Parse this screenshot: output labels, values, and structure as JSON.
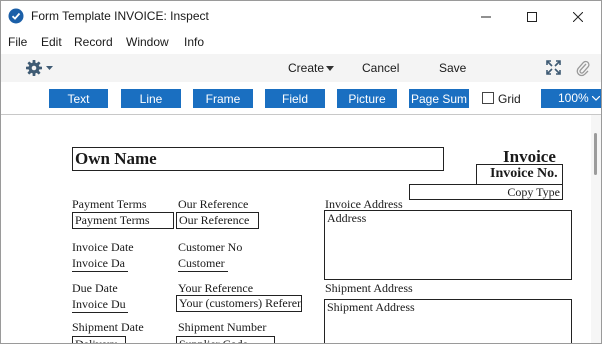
{
  "window": {
    "title": "Form Template INVOICE: Inspect"
  },
  "menu": [
    "File",
    "Edit",
    "Record",
    "Window",
    "Info"
  ],
  "toolbar": {
    "create_label": "Create",
    "cancel_label": "Cancel",
    "save_label": "Save"
  },
  "tools": [
    "Text",
    "Line",
    "Frame",
    "Field",
    "Picture",
    "Page Sum"
  ],
  "grid_label": "Grid",
  "zoom_value": "100%",
  "colors": {
    "accent": "#1a6fc1"
  },
  "form": {
    "own_name": "Own Name",
    "invoice_title": "Invoice",
    "invoice_no": "Invoice No.",
    "copy_type": "Copy Type",
    "payment_terms_label": "Payment Terms",
    "payment_terms_field": "Payment Terms",
    "our_reference_label": "Our Reference",
    "our_reference_field": "Our Reference",
    "invoice_address_label": "Invoice Address",
    "address_field": "Address",
    "invoice_date_label": "Invoice Date",
    "invoice_date_field": "Invoice Da",
    "customer_no_label": "Customer No",
    "customer_field": "Customer",
    "due_date_label": "Due Date",
    "due_date_field": "Invoice Du",
    "your_reference_label": "Your Reference",
    "your_reference_field": "Your (customers) Referen",
    "shipment_address_label": "Shipment Address",
    "shipment_address_field": "Shipment Address",
    "shipment_date_label": "Shipment Date",
    "delivery_field": "Delivery",
    "shipment_number_label": "Shipment Number",
    "supplier_code_field": "Supplier Code"
  }
}
